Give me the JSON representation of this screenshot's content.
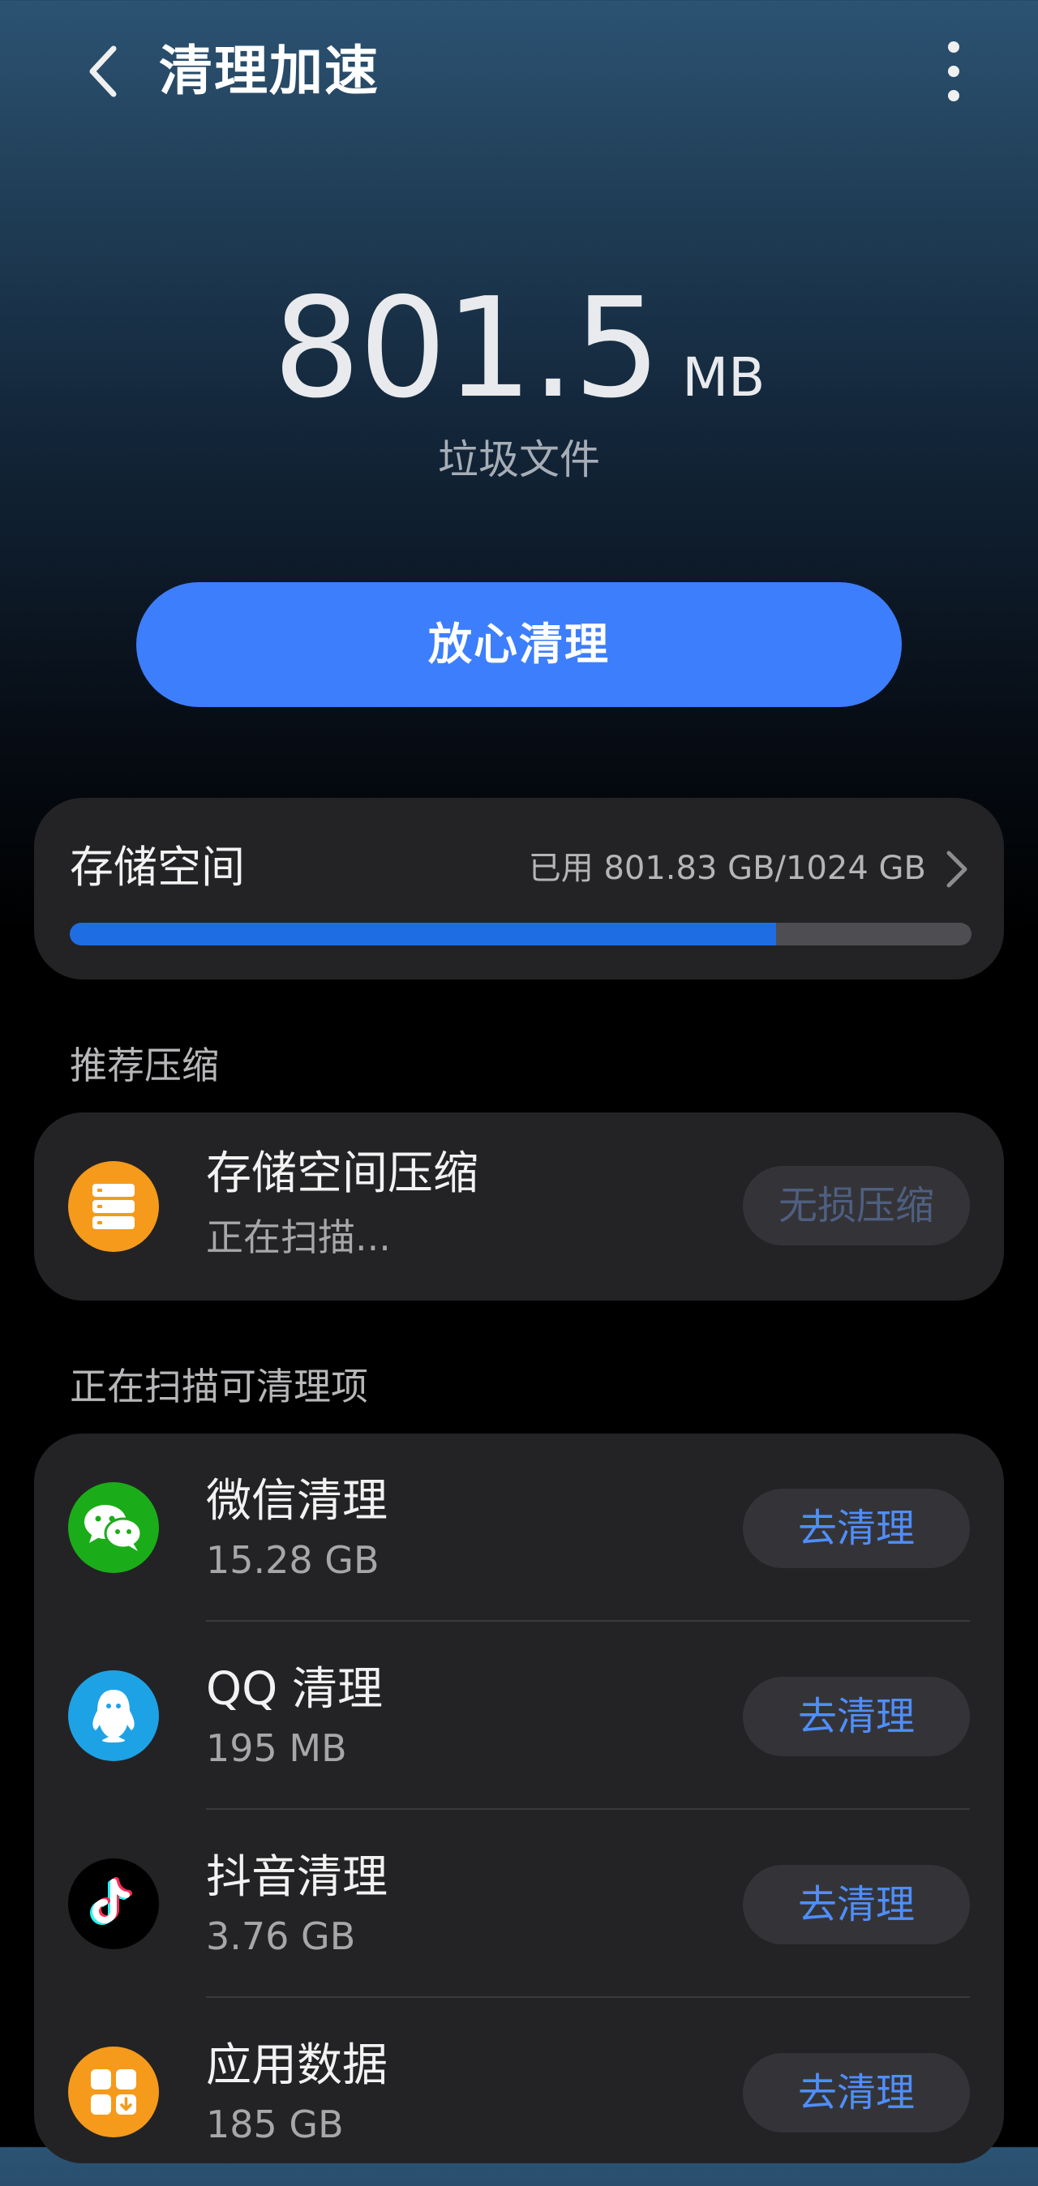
{
  "header": {
    "title": "清理加速",
    "back_icon": "chevron-left-icon",
    "more_icon": "more-vertical-icon"
  },
  "junk": {
    "value": "801.5",
    "unit": "MB",
    "label": "垃圾文件"
  },
  "clean_button": {
    "label": "放心清理",
    "color": "#3d7efc"
  },
  "storage": {
    "title": "存储空间",
    "usage": "已用 801.83 GB/1024 GB",
    "used_fraction": 0.783,
    "bar_color": "#1f6de3"
  },
  "recommend": {
    "section_title": "推荐压缩",
    "item": {
      "title": "存储空间压缩",
      "subtitle": "正在扫描...",
      "button": "无损压缩",
      "icon": "storage-compress-icon",
      "icon_color": "#f59a1b"
    }
  },
  "scan": {
    "section_title": "正在扫描可清理项",
    "items": [
      {
        "title": "微信清理",
        "size": "15.28 GB",
        "button": "去清理",
        "icon": "wechat-icon",
        "icon_color": "#1aad19"
      },
      {
        "title": "QQ 清理",
        "size": "195 MB",
        "button": "去清理",
        "icon": "qq-icon",
        "icon_color": "#1ea2e6"
      },
      {
        "title": "抖音清理",
        "size": "3.76 GB",
        "button": "去清理",
        "icon": "douyin-icon",
        "icon_color": "#000000"
      },
      {
        "title": "应用数据",
        "size": "185 GB",
        "button": "去清理",
        "icon": "app-data-icon",
        "icon_color": "#f59a1b"
      }
    ]
  }
}
